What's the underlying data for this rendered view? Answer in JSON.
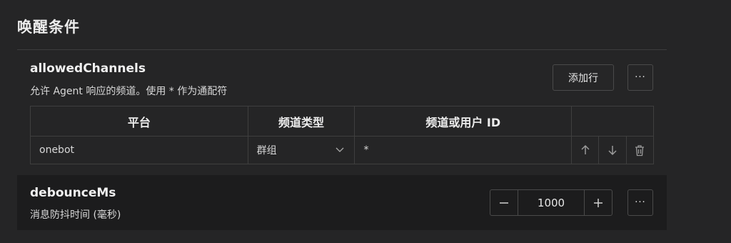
{
  "section": {
    "title": "唤醒条件"
  },
  "allowed_channels": {
    "name": "allowedChannels",
    "description": "允许 Agent 响应的频道。使用 * 作为通配符",
    "add_row_label": "添加行",
    "more_label": "···",
    "columns": [
      "平台",
      "频道类型",
      "频道或用户 ID",
      ""
    ],
    "rows": [
      {
        "platform": "onebot",
        "channel_type": "群组",
        "channel_id": "*"
      }
    ]
  },
  "debounce": {
    "name": "debounceMs",
    "description": "消息防抖时间 (毫秒)",
    "value": "1000",
    "decrement_label": "−",
    "increment_label": "+",
    "more_label": "···"
  },
  "colors": {
    "background": "#252526",
    "panel_dark": "#1c1c1d",
    "border": "#3f3f3f",
    "text": "#e6e6e6"
  }
}
